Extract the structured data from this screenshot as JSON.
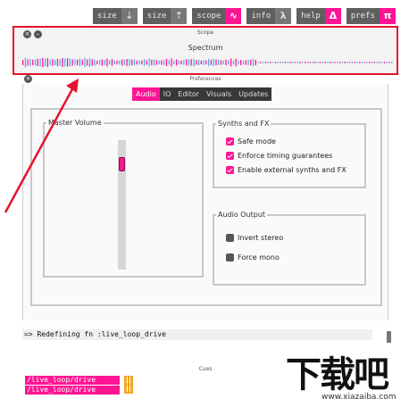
{
  "toolbar": {
    "buttons": [
      {
        "label": "size",
        "icon": "arrow-down-icon",
        "glyph": "⇣",
        "color": "#777777"
      },
      {
        "label": "size",
        "icon": "arrow-up-icon",
        "glyph": "⇡",
        "color": "#777777"
      },
      {
        "label": "scope",
        "icon": "waveform-icon",
        "glyph": "∿",
        "color": "#ff1493"
      },
      {
        "label": "info",
        "icon": "lambda-icon",
        "glyph": "λ",
        "color": "#777777"
      },
      {
        "label": "help",
        "icon": "delta-icon",
        "glyph": "Δ",
        "color": "#ff1493"
      },
      {
        "label": "prefs",
        "icon": "pi-icon",
        "glyph": "π",
        "color": "#ff1493"
      }
    ]
  },
  "scope": {
    "title": "Scope",
    "subtitle": "Spectrum",
    "close_glyph": "×",
    "min_glyph": "–"
  },
  "preferences": {
    "title": "Preferences",
    "close_glyph": "×",
    "tabs": [
      {
        "label": "Audio",
        "active": true
      },
      {
        "label": "IO",
        "active": false
      },
      {
        "label": "Editor",
        "active": false
      },
      {
        "label": "Visuals",
        "active": false
      },
      {
        "label": "Updates",
        "active": false
      }
    ],
    "master_volume": {
      "label": "Master Volume",
      "level": 0.85
    },
    "synths_fx": {
      "label": "Synths and FX",
      "options": [
        {
          "label": "Safe mode",
          "checked": true
        },
        {
          "label": "Enforce timing guarantees",
          "checked": true
        },
        {
          "label": "Enable external synths and FX",
          "checked": true
        }
      ]
    },
    "audio_output": {
      "label": "Audio Output",
      "options": [
        {
          "label": "Invert stereo",
          "checked": false
        },
        {
          "label": "Force mono",
          "checked": false
        }
      ]
    }
  },
  "log": {
    "line": "=> Redefining fn :live_loop_drive"
  },
  "cues": {
    "title": "Cues",
    "items": [
      "/live_loop/drive",
      "/live_loop/drive"
    ]
  },
  "watermark": {
    "glyphs": "下载吧",
    "site": "www.xiazaiba.com"
  },
  "colors": {
    "accent": "#ff1493",
    "highlight_border": "#e5142c",
    "wave_blue": "#5aa9e6",
    "wave_pink": "#ff1493"
  }
}
